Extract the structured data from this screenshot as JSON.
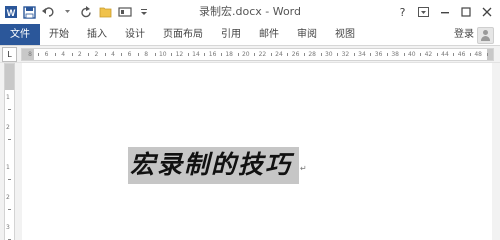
{
  "window": {
    "title": "录制宏.docx - Word"
  },
  "quick_access": {
    "icons": [
      "word-icon",
      "save-icon",
      "undo-icon",
      "redo-icon",
      "open-icon",
      "view-icon",
      "customize-icon"
    ]
  },
  "window_controls": {
    "help": "?"
  },
  "ribbon": {
    "file_tab": "文件",
    "tabs": [
      "开始",
      "插入",
      "设计",
      "页面布局",
      "引用",
      "邮件",
      "审阅",
      "视图"
    ],
    "login": "登录"
  },
  "ruler": {
    "tab_selector": "L",
    "h_numbers": [
      "8",
      "6",
      "4",
      "2",
      "2",
      "4",
      "6",
      "8",
      "10",
      "12",
      "14",
      "16",
      "18",
      "20",
      "22",
      "24",
      "26",
      "28",
      "30",
      "32",
      "34",
      "36",
      "38",
      "40",
      "42",
      "44",
      "46",
      "48"
    ],
    "v_numbers": [
      "1",
      "2",
      "1",
      "2",
      "3"
    ]
  },
  "document": {
    "text": "宏录制的技巧",
    "paragraph_mark": "↵"
  },
  "colors": {
    "accent": "#2b579a",
    "selection": "#c6c6c6"
  }
}
